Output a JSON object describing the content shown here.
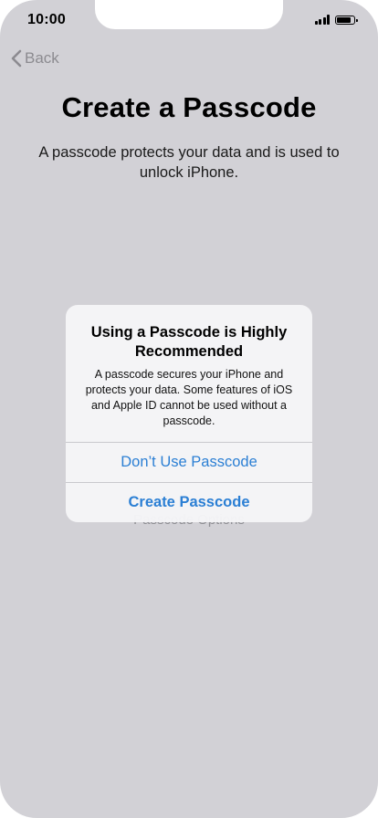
{
  "status_bar": {
    "time": "10:00",
    "signal_bars": 4,
    "battery_level": 0.9
  },
  "nav": {
    "back_label": "Back",
    "back_icon": "chevron-left-icon"
  },
  "page": {
    "title": "Create a Passcode",
    "subtitle": "A passcode protects your data and is used to unlock iPhone.",
    "options_label": "Passcode Options"
  },
  "alert": {
    "title": "Using a Passcode is Highly Recommended",
    "message": "A passcode secures your iPhone and protects your data. Some features of iOS and Apple ID cannot be used without a passcode.",
    "buttons": [
      {
        "label": "Don’t Use Passcode"
      },
      {
        "label": "Create Passcode"
      }
    ]
  },
  "colors": {
    "background": "#d2d1d6",
    "accent": "#2b7fd4",
    "muted": "#8c8b90"
  }
}
